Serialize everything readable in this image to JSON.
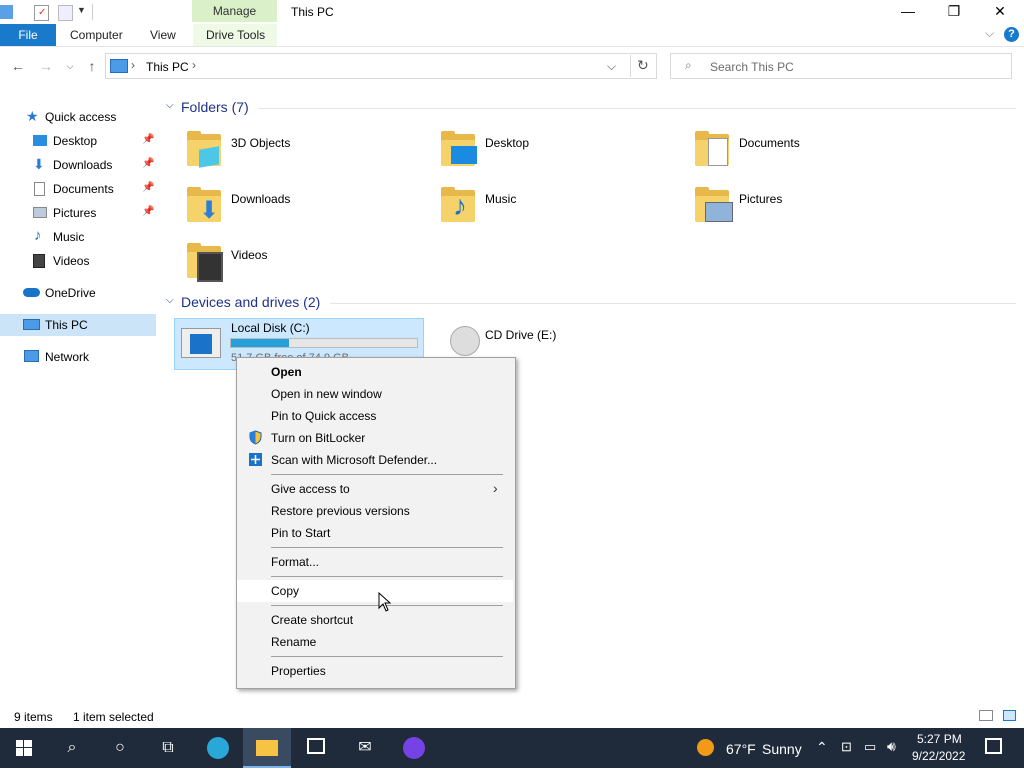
{
  "titlebar": {
    "manage_tab": "Manage",
    "title": "This PC",
    "minimize": "—",
    "maximize": "❐",
    "close": "✕"
  },
  "ribbon": {
    "file": "File",
    "tabs": [
      "Computer",
      "View",
      "Drive Tools"
    ],
    "chevron": "⌵",
    "help": "?"
  },
  "address": {
    "path_root": "This PC",
    "sep": "›",
    "dropdown": "⌵",
    "refresh": "↻"
  },
  "search": {
    "placeholder": "Search This PC"
  },
  "nav": {
    "quick_access": "Quick access",
    "items": [
      {
        "label": "Desktop",
        "pinned": true
      },
      {
        "label": "Downloads",
        "pinned": true
      },
      {
        "label": "Documents",
        "pinned": true
      },
      {
        "label": "Pictures",
        "pinned": true
      },
      {
        "label": "Music",
        "pinned": false
      },
      {
        "label": "Videos",
        "pinned": false
      }
    ],
    "onedrive": "OneDrive",
    "thispc": "This PC",
    "network": "Network"
  },
  "folders": {
    "header": "Folders (7)",
    "items": [
      "3D Objects",
      "Desktop",
      "Documents",
      "Downloads",
      "Music",
      "Pictures",
      "Videos"
    ]
  },
  "devices": {
    "header": "Devices and drives (2)",
    "local_disk": {
      "name": "Local Disk (C:)",
      "space": "51.7 GB free of 74.9 GB",
      "used_fraction": 0.31
    },
    "cd_drive": {
      "name": "CD Drive (E:)"
    }
  },
  "context_menu": {
    "items": [
      {
        "label": "Open",
        "bold": true
      },
      {
        "label": "Open in new window"
      },
      {
        "label": "Pin to Quick access"
      },
      {
        "label": "Turn on BitLocker",
        "icon": "shield-icon"
      },
      {
        "label": "Scan with Microsoft Defender...",
        "icon": "defender-icon"
      },
      {
        "label": "Give access to",
        "submenu": true
      },
      {
        "label": "Restore previous versions"
      },
      {
        "label": "Pin to Start"
      },
      {
        "label": "Format..."
      },
      {
        "label": "Copy"
      },
      {
        "label": "Create shortcut"
      },
      {
        "label": "Rename"
      },
      {
        "label": "Properties"
      }
    ],
    "submenu_arrow": "›"
  },
  "status": {
    "items": "9 items",
    "selected": "1 item selected"
  },
  "taskbar": {
    "weather_temp": "67°F",
    "weather_desc": "Sunny",
    "time": "5:27 PM",
    "date": "9/22/2022"
  },
  "colors": {
    "accent": "#1979ca",
    "selection": "#cce8ff",
    "taskbar": "#1f2a3a",
    "group_header": "#1e3287"
  }
}
